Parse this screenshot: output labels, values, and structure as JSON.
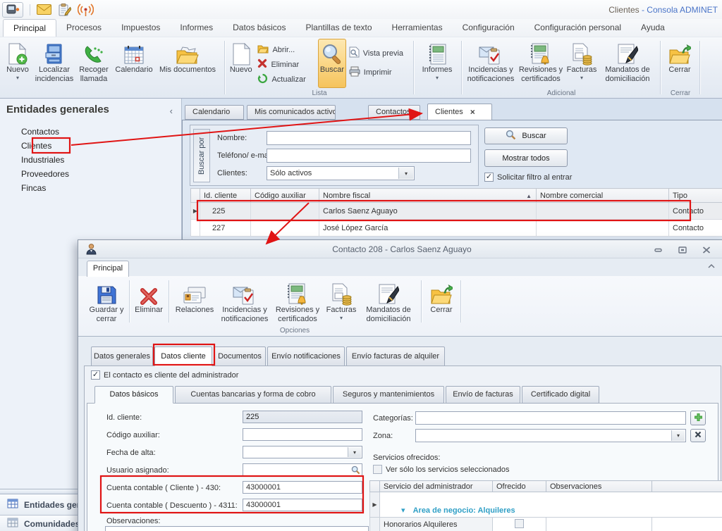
{
  "titlebar": {
    "title_page": "Clientes",
    "title_app": " - Consola ADMINET"
  },
  "menubar": {
    "items": [
      "Principal",
      "Procesos",
      "Impuestos",
      "Informes",
      "Datos básicos",
      "Plantillas de texto",
      "Herramientas",
      "Configuración",
      "Configuración personal",
      "Ayuda"
    ]
  },
  "ribbon": {
    "entidades": {
      "nuevo": "Nuevo",
      "localizar": "Localizar incidencias",
      "recoger": "Recoger llamada",
      "calendario": "Calendario",
      "mis_documentos": "Mis documentos"
    },
    "lista": {
      "label": "Lista",
      "nuevo": "Nuevo",
      "abrir": "Abrir...",
      "eliminar": "Eliminar",
      "actualizar": "Actualizar",
      "buscar": "Buscar",
      "vista_previa": "Vista previa",
      "imprimir": "Imprimir"
    },
    "informes": "Informes",
    "adicional": {
      "label": "Adicional",
      "incidencias": "Incidencias y notificaciones",
      "revisiones": "Revisiones y certificados",
      "facturas": "Facturas",
      "mandatos": "Mandatos de domiciliación"
    },
    "cerrar": {
      "label": "Cerrar",
      "boton": "Cerrar"
    }
  },
  "sidebar": {
    "title": "Entidades generales",
    "items": [
      "Contactos",
      "Clientes",
      "Industriales",
      "Proveedores",
      "Fincas"
    ],
    "nav_buttons": [
      "Entidades generales",
      "Comunidades"
    ]
  },
  "tabstrip": {
    "tabs": [
      "Calendario",
      "Mis comunicados activos",
      "Contactos",
      "Clientes"
    ]
  },
  "search": {
    "side_label": "Buscar por",
    "nombre_label": "Nombre:",
    "telefono_label": "Teléfono/ e-mail:",
    "clientes_label": "Clientes:",
    "clientes_value": "Sólo activos",
    "buscar": "Buscar",
    "mostrar_todos": "Mostrar todos",
    "solicitar": "Solicitar filtro al entrar"
  },
  "clients_table": {
    "columns": [
      "Id. cliente",
      "Código auxiliar",
      "Nombre fiscal",
      "Nombre comercial",
      "Tipo"
    ],
    "rows": [
      {
        "id": "225",
        "codigo": "",
        "fiscal": "Carlos Saenz Aguayo",
        "comercial": "",
        "tipo": "Contacto"
      },
      {
        "id": "227",
        "codigo": "",
        "fiscal": "José López García",
        "comercial": "",
        "tipo": "Contacto"
      }
    ]
  },
  "dialog": {
    "title": "Contacto 208 - Carlos Saenz Aguayo",
    "tab": "Principal",
    "ribbon": {
      "guardar": "Guardar y cerrar",
      "eliminar": "Eliminar",
      "relaciones": "Relaciones",
      "incidencias": "Incidencias y notificaciones",
      "revisiones": "Revisiones y certificados",
      "facturas": "Facturas",
      "mandatos": "Mandatos de domiciliación",
      "cerrar": "Cerrar",
      "grupo": "Opciones"
    },
    "tabs": [
      "Datos generales",
      "Datos cliente",
      "Documentos",
      "Envío notificaciones",
      "Envío facturas de alquiler"
    ],
    "cliente_checkbox": "El contacto es cliente del administrador",
    "subtabs": [
      "Datos básicos",
      "Cuentas bancarias y forma de cobro",
      "Seguros y mantenimientos",
      "Envío de facturas",
      "Certificado digital"
    ],
    "form": {
      "id_label": "Id. cliente:",
      "id_value": "225",
      "codigo_label": "Código auxiliar:",
      "codigo_value": "",
      "fecha_label": "Fecha de alta:",
      "fecha_value": "",
      "usuario_label": "Usuario asignado:",
      "usuario_value": "",
      "cuenta_cliente_label": "Cuenta contable ( Cliente ) - 430:",
      "cuenta_cliente_value": "43000001",
      "cuenta_descuento_label": "Cuenta contable ( Descuento ) - 4311:",
      "cuenta_descuento_value": "43000001",
      "observaciones_label": "Observaciones:"
    },
    "derecha": {
      "categorias_label": "Categorías:",
      "categorias_value": "",
      "zona_label": "Zona:",
      "zona_value": "",
      "servicios_label": "Servicios ofrecidos:",
      "ver_solo": "Ver sólo los servicios seleccionados",
      "columns": [
        "Servicio del administrador",
        "Ofrecido",
        "Observaciones"
      ],
      "grupo_fila": "Area de negocio: Alquileres",
      "servicio_fila": "Honorarios Alquileres"
    }
  },
  "glyphs": {
    "dropdown": "▾",
    "sort_asc": "▲",
    "check": "✓",
    "close": "×",
    "collapse_left": "‹",
    "row_selector": "▶",
    "group_collapse": "▾"
  },
  "colors": {
    "annotation_red": "#e01414",
    "app_blue": "#4a74c8",
    "teal_group": "#2f9fc6",
    "buscar_highlight": "#f5c35c"
  }
}
